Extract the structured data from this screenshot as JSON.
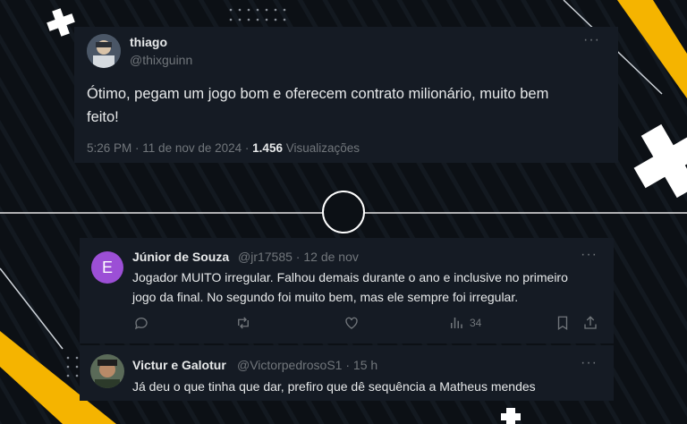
{
  "tweet": {
    "author_name": "thiago",
    "author_handle": "@thixguinn",
    "text_line1": "Ótimo, pegam um jogo bom e oferecem contrato milionário, muito bem",
    "text_line2": "feito!",
    "time": "5:26 PM",
    "date": "11 de nov de 2024",
    "views_count": "1.456",
    "views_label": "Visualizações",
    "more_label": "···"
  },
  "replies": [
    {
      "author_name": "Júnior de Souza",
      "author_handle": "@jr17585",
      "timestamp": "12 de nov",
      "avatar_letter": "E",
      "text_line1": "Jogador MUITO irregular. Falhou demais durante o ano e inclusive no primeiro",
      "text_line2": "jogo da final. No segundo foi muito bem, mas ele sempre foi irregular.",
      "views": "34",
      "more_label": "···"
    },
    {
      "author_name": "Victur e Galotur",
      "author_handle": "@VictorpedrosoS1",
      "timestamp": "15 h",
      "text_line1": "Já deu o que tinha que dar, prefiro que dê sequência a Matheus mendes",
      "more_label": "···"
    }
  ],
  "colors": {
    "accent_yellow": "#f5b400",
    "background": "#0c1015",
    "card": "#151b24"
  }
}
